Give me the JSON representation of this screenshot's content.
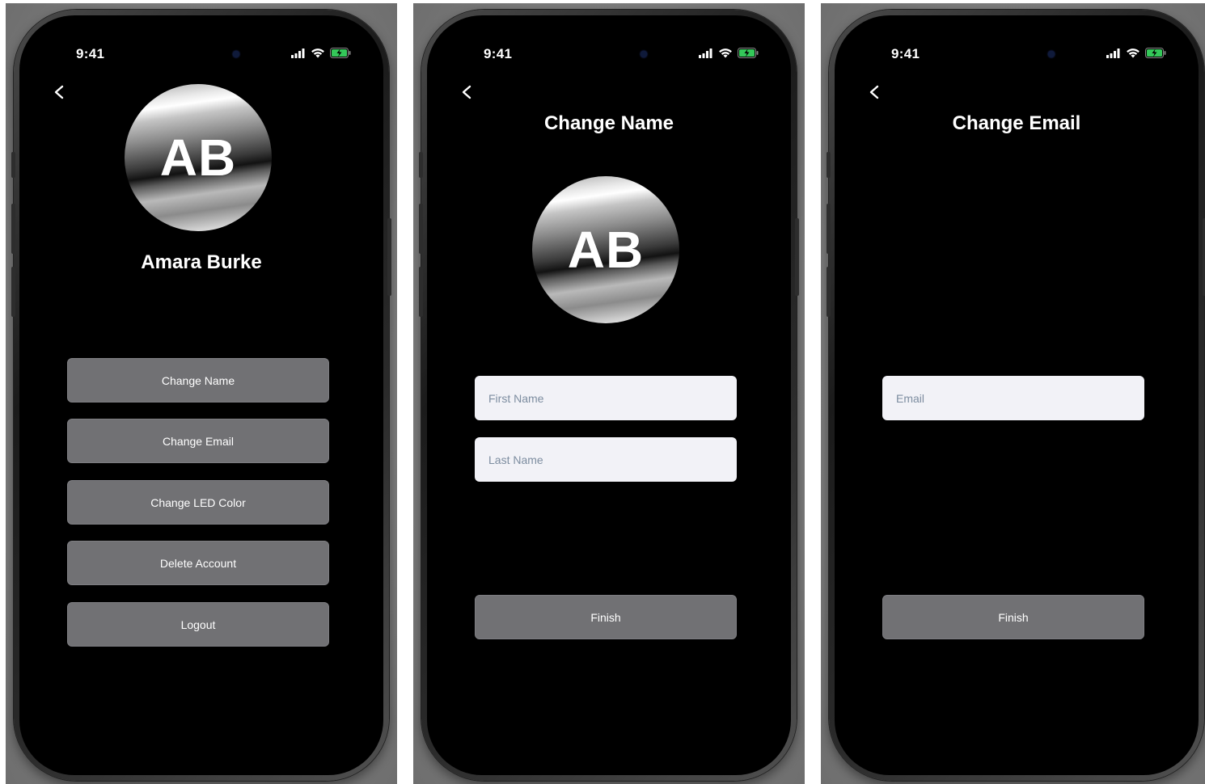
{
  "status_bar": {
    "time": "9:41"
  },
  "profile_screen": {
    "avatar_initials": "AB",
    "user_name": "Amara Burke",
    "buttons": [
      {
        "label": "Change Name"
      },
      {
        "label": "Change Email"
      },
      {
        "label": "Change LED Color"
      },
      {
        "label": "Delete Account"
      },
      {
        "label": "Logout"
      }
    ]
  },
  "change_name_screen": {
    "title": "Change Name",
    "avatar_initials": "AB",
    "first_name_placeholder": "First Name",
    "last_name_placeholder": "Last Name",
    "finish_label": "Finish"
  },
  "change_email_screen": {
    "title": "Change Email",
    "email_placeholder": "Email",
    "finish_label": "Finish"
  },
  "icons": {
    "back": "chevron-left-icon",
    "signal": "cellular-signal-icon",
    "wifi": "wifi-icon",
    "battery": "battery-charging-icon"
  },
  "colors": {
    "screen_background": "#000000",
    "button_background": "#717174",
    "field_background": "#f2f2f7",
    "placeholder_text": "#7d8da0",
    "battery_charging": "#34c759"
  }
}
